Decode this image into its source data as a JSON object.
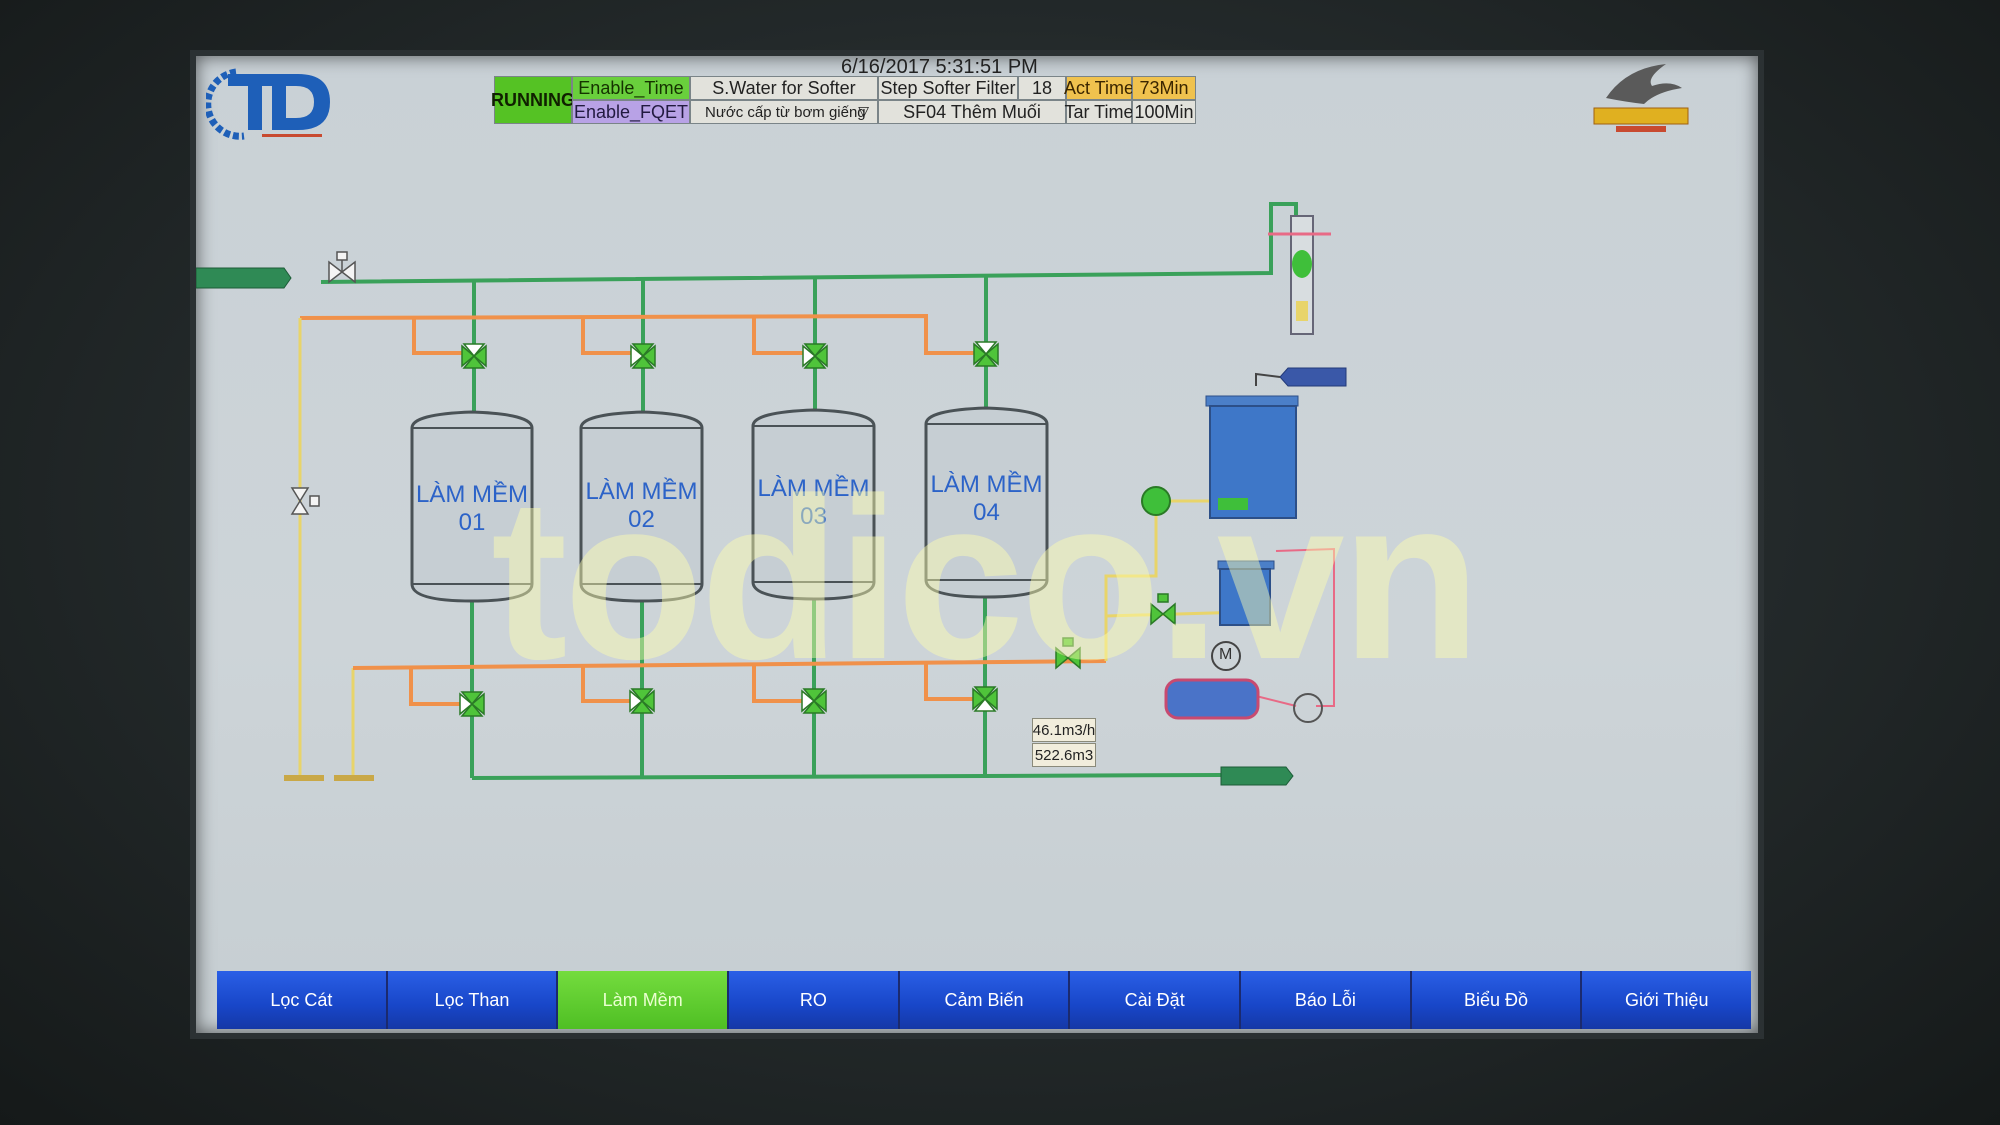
{
  "header": {
    "datetime": "6/16/2017 5:31:51 PM",
    "status": "RUNNING",
    "enable_time": "Enable_Time",
    "enable_fqet": "Enable_FQET",
    "mode": "S.Water for Softer",
    "source_select": "Nước cấp từ bơm giếng",
    "step_label": "Step Softer Filter",
    "step_value": "18",
    "step_name": "SF04 Thêm Muối",
    "act_time_label": "Act Time",
    "act_time_value": "73Min",
    "tar_time_label": "Tar Time",
    "tar_time_value": "100Min"
  },
  "tanks": [
    {
      "name": "LÀM MỀM",
      "number": "01"
    },
    {
      "name": "LÀM MỀM",
      "number": "02"
    },
    {
      "name": "LÀM MỀM",
      "number": "03"
    },
    {
      "name": "LÀM MỀM",
      "number": "04"
    }
  ],
  "readouts": {
    "flow": "46.1m3/h",
    "total": "522.6m3"
  },
  "motor_label": "M",
  "watermark": "todico.vn",
  "nav": [
    {
      "label": "Lọc Cát",
      "active": false
    },
    {
      "label": "Lọc Than",
      "active": false
    },
    {
      "label": "Làm Mềm",
      "active": true
    },
    {
      "label": "RO",
      "active": false
    },
    {
      "label": "Cảm Biến",
      "active": false
    },
    {
      "label": "Cài Đặt",
      "active": false
    },
    {
      "label": "Báo Lỗi",
      "active": false
    },
    {
      "label": "Biểu Đồ",
      "active": false
    },
    {
      "label": "Giới Thiệu",
      "active": false
    }
  ],
  "colors": {
    "pipe_green": "#3aa15a",
    "pipe_orange": "#f0914a",
    "pipe_yellow": "#e8d46a",
    "pipe_pink": "#e86a86",
    "valve_green": "#4fc43a",
    "nav_blue": "#1846c8",
    "nav_active": "#4fbf24"
  }
}
